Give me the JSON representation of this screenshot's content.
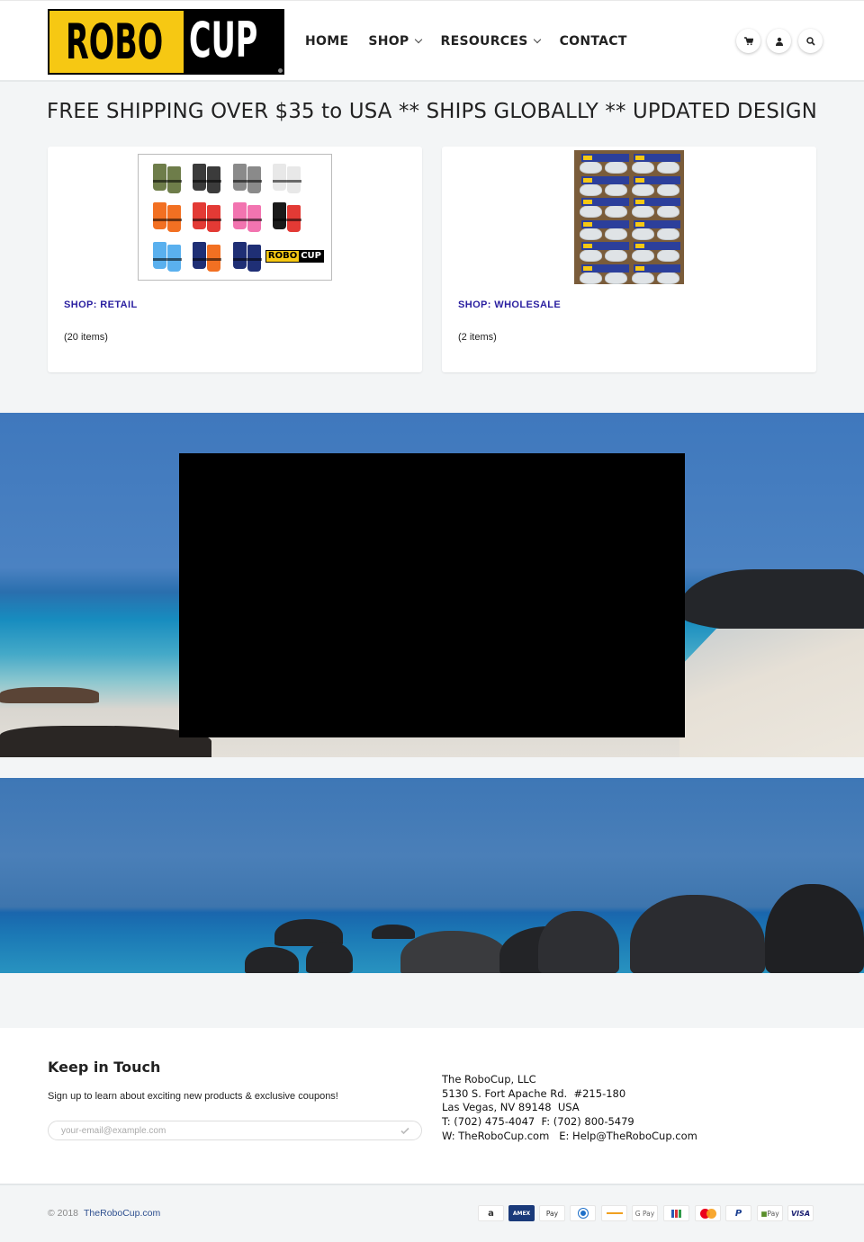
{
  "header": {
    "logo": {
      "left_text": "ROBO",
      "right_text": "CUP",
      "colors": {
        "yellow": "#f6c813",
        "black": "#000000"
      }
    },
    "nav": [
      {
        "label": "HOME",
        "has_dropdown": false
      },
      {
        "label": "SHOP",
        "has_dropdown": true
      },
      {
        "label": "RESOURCES",
        "has_dropdown": true
      },
      {
        "label": "CONTACT",
        "has_dropdown": false
      }
    ],
    "icons": [
      "cart-icon",
      "account-icon",
      "search-icon"
    ]
  },
  "banner": {
    "text": "FREE SHIPPING OVER $35 to USA ** SHIPS GLOBALLY ** UPDATED DESIGN"
  },
  "collections": [
    {
      "title": "SHOP: RETAIL",
      "count": "(20 items)",
      "image_alt": "RoboCup color variants grid"
    },
    {
      "title": "SHOP: WHOLESALE",
      "count": "(2 items)",
      "image_alt": "Box of packaged RoboCups"
    }
  ],
  "retail_swatches": [
    [
      "#6e7d4a",
      "#6e7d4a"
    ],
    [
      "#3b3b3b",
      "#3b3b3b"
    ],
    [
      "#8a8a8a",
      "#8a8a8a"
    ],
    [
      "#e8e8e8",
      "#e8e8e8"
    ],
    [
      "#f27022",
      "#f27022"
    ],
    [
      "#e33a35",
      "#e33a35"
    ],
    [
      "#f274b0",
      "#f274b0"
    ],
    [
      "#1a1a1a",
      "#e33a35"
    ],
    [
      "#5ab0ee",
      "#5ab0ee"
    ],
    [
      "#1f2f75",
      "#f27022"
    ],
    [
      "#1f2f75",
      "#1f2f75"
    ]
  ],
  "mini_logo": {
    "left": "ROBO",
    "right": "CUP"
  },
  "video": {
    "state": "black placeholder"
  },
  "footer": {
    "title": "Keep in Touch",
    "subtitle": "Sign up to learn about exciting new products & exclusive coupons!",
    "email_placeholder": "your-email@example.com",
    "email_value": "",
    "address": "The RoboCup, LLC\n5130 S. Fort Apache Rd.  #215-180\nLas Vegas, NV 89148  USA\nT: (702) 475-4047  F: (702) 800-5479\nW: TheRoboCup.com   E: Help@TheRoboCup.com"
  },
  "bottom": {
    "copyright": "© 2018",
    "site_link": "TheRoboCup.com",
    "payments": [
      "Amazon",
      "American Express",
      "Apple Pay",
      "Diners Club",
      "Discover",
      "Google Pay",
      "JCB",
      "Mastercard",
      "PayPal",
      "Shopify Pay",
      "Visa"
    ]
  }
}
